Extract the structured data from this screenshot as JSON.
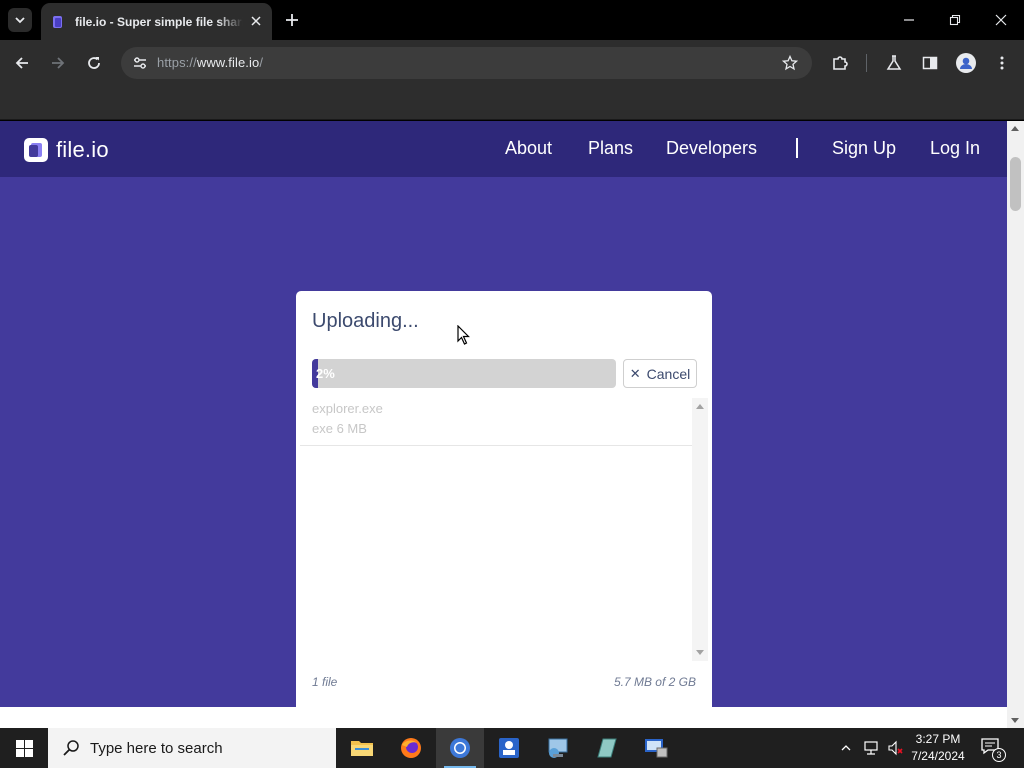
{
  "browser": {
    "tab_title": "file.io - Super simple file sharing",
    "url_scheme": "https://",
    "url_host": "www.file.io",
    "url_path": "/"
  },
  "site": {
    "logo_text": "file.io",
    "nav": {
      "about": "About",
      "plans": "Plans",
      "developers": "Developers",
      "signup": "Sign Up",
      "login": "Log In"
    },
    "brand_color": "#433a9c",
    "nav_color": "#2e287a"
  },
  "upload": {
    "title": "Uploading...",
    "progress_percent": 2,
    "progress_label": "2%",
    "cancel_label": "Cancel",
    "files": [
      {
        "name": "explorer.exe",
        "meta": "exe 6 MB"
      }
    ],
    "file_count": "1 file",
    "usage": "5.7 MB of 2 GB"
  },
  "taskbar": {
    "search_placeholder": "Type here to search",
    "time": "3:27 PM",
    "date": "7/24/2024",
    "notification_count": "3"
  }
}
